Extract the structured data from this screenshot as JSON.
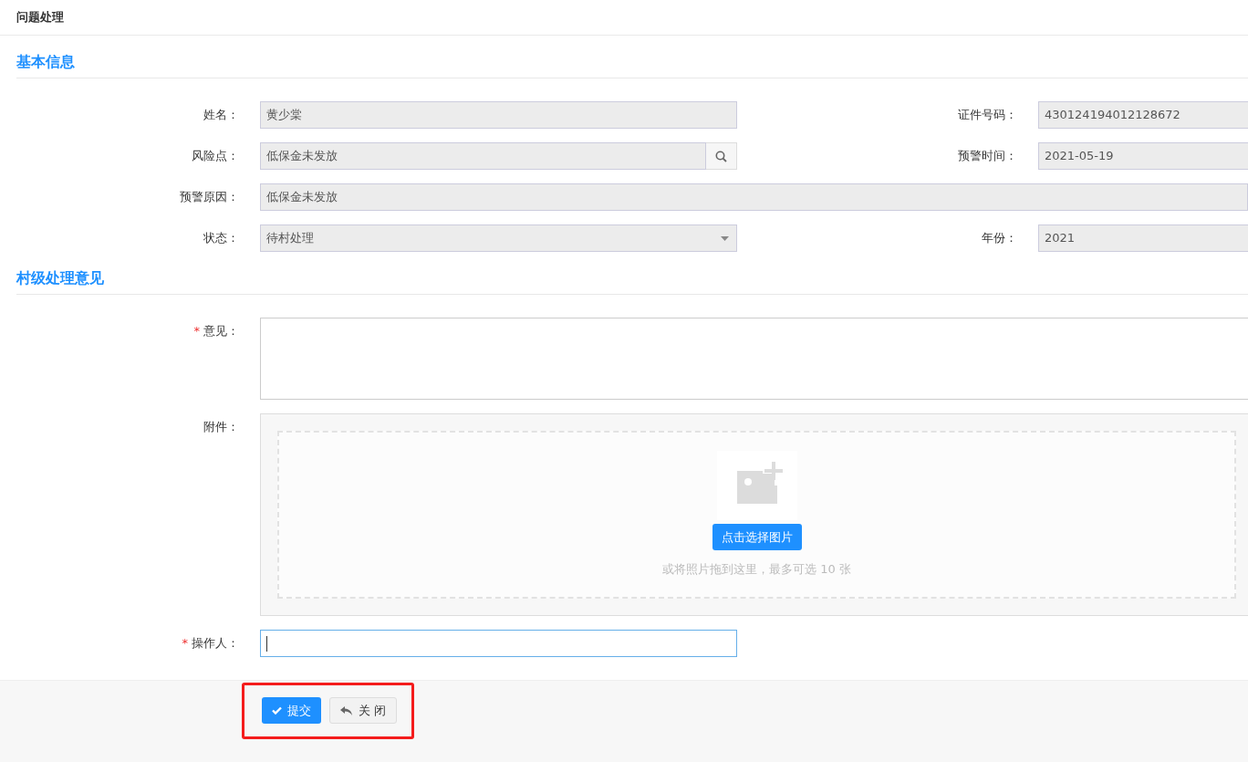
{
  "page_title": "问题处理",
  "sections": [
    {
      "title": "基本信息",
      "rows": [
        [
          {
            "kind": "text",
            "label": "姓名：",
            "value": "黄少棠"
          },
          {
            "kind": "text",
            "label": "证件号码：",
            "value": "430124194012128672"
          }
        ],
        [
          {
            "kind": "search",
            "label": "风险点：",
            "value": "低保金未发放"
          },
          {
            "kind": "text",
            "label": "预警时间：",
            "value": "2021-05-19"
          }
        ],
        [
          {
            "kind": "wide",
            "label": "预警原因：",
            "value": "低保金未发放"
          }
        ],
        [
          {
            "kind": "select",
            "label": "状态：",
            "value": "待村处理"
          },
          {
            "kind": "text",
            "label": "年份：",
            "value": "2021"
          }
        ]
      ]
    },
    {
      "title": "村级处理意见",
      "rows": [
        [
          {
            "kind": "textarea",
            "label": "意见：",
            "required_mark": "*"
          }
        ],
        [
          {
            "kind": "upload",
            "label": "附件：",
            "button": "点击选择图片",
            "hint": "或将照片拖到这里，最多可选 10 张"
          }
        ],
        [
          {
            "kind": "input",
            "label": "操作人：",
            "required_mark": "*",
            "focused": true
          }
        ]
      ]
    }
  ],
  "footer": {
    "highlighted": true,
    "buttons": [
      {
        "kind": "primary",
        "label": "提交"
      },
      {
        "kind": "default",
        "label": "关 闭"
      }
    ]
  }
}
